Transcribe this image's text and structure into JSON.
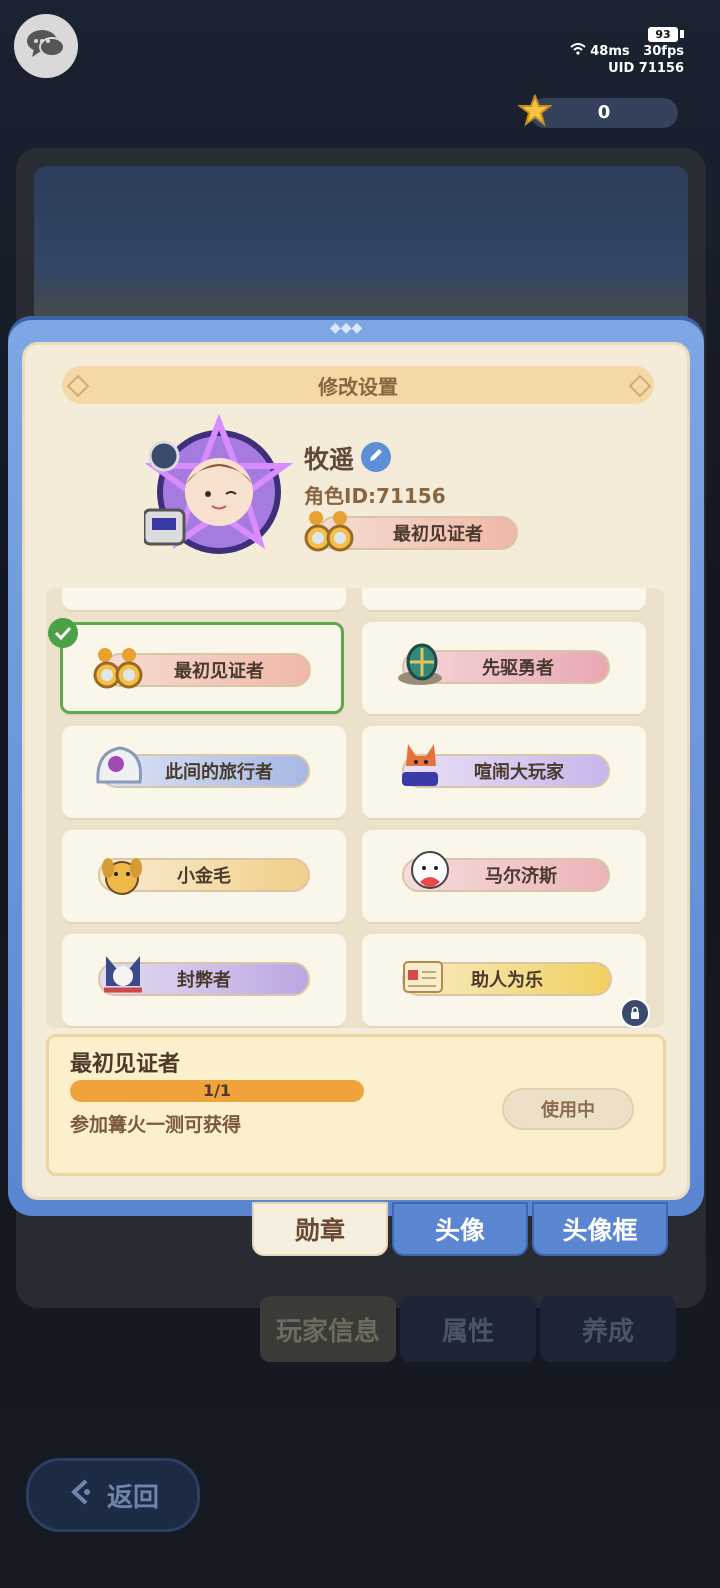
{
  "hud": {
    "battery": "93",
    "ping": "48ms",
    "fps": "30fps",
    "uid": "UID 71156",
    "currency_value": "0",
    "icons": [
      "chat-icon",
      "wifi-icon",
      "star-coin-icon"
    ]
  },
  "background": {
    "tabs": [
      "玩家信息",
      "属性",
      "养成"
    ],
    "back_label": "返回"
  },
  "modal": {
    "title": "修改设置",
    "player_name": "牧遥",
    "player_id": "角色ID:71156",
    "equipped_badge": "最初见证者",
    "badges": [
      {
        "label": "最初见证者",
        "selected": true,
        "icon": "binoculars-icon"
      },
      {
        "label": "先驱勇者",
        "selected": false,
        "icon": "shield-egg-icon"
      },
      {
        "label": "此间的旅行者",
        "selected": false,
        "icon": "shell-icon"
      },
      {
        "label": "喧闹大玩家",
        "selected": false,
        "icon": "fox-hat-icon"
      },
      {
        "label": "小金毛",
        "selected": false,
        "icon": "golden-dog-icon"
      },
      {
        "label": "马尔济斯",
        "selected": false,
        "icon": "white-dog-icon"
      },
      {
        "label": "封弊者",
        "selected": false,
        "icon": "fox-warrior-icon"
      },
      {
        "label": "助人为乐",
        "selected": false,
        "icon": "scroll-icon",
        "locked": true
      }
    ],
    "detail": {
      "name": "最初见证者",
      "progress_text": "1/1",
      "progress": 1.0,
      "description": "参加篝火一测可获得",
      "button": "使用中"
    },
    "tabs": [
      {
        "label": "勋章",
        "active": true
      },
      {
        "label": "头像",
        "active": false
      },
      {
        "label": "头像框",
        "active": false
      }
    ]
  }
}
